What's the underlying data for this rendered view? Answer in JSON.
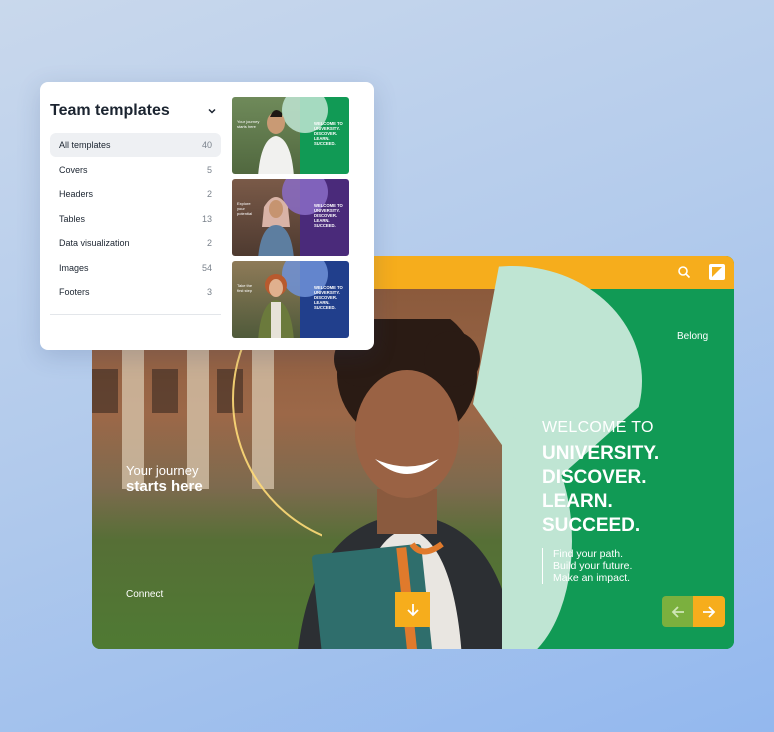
{
  "panel": {
    "title": "Team templates",
    "categories": [
      {
        "label": "All templates",
        "count": "40",
        "active": true
      },
      {
        "label": "Covers",
        "count": "5"
      },
      {
        "label": "Headers",
        "count": "2"
      },
      {
        "label": "Tables",
        "count": "13"
      },
      {
        "label": "Data visualization",
        "count": "2"
      },
      {
        "label": "Images",
        "count": "54"
      },
      {
        "label": "Footers",
        "count": "3"
      }
    ],
    "thumbnails": [
      {
        "left_text": "Your journey\nstarts here",
        "right_text": "WELCOME TO\nUNIVERSITY.\nDISCOVER.\nLEARN.\nSUCCEED.",
        "panel_color": "#119a55"
      },
      {
        "left_text": "Explore\nyour\npotential",
        "right_text": "WELCOME TO\nUNIVERSITY.\nDISCOVER.\nLEARN.\nSUCCEED.",
        "panel_color": "#4a2a7a"
      },
      {
        "left_text": "Take the\nfirst step",
        "right_text": "WELCOME TO\nUNIVERSITY.\nDISCOVER.\nLEARN.\nSUCCEED.",
        "panel_color": "#213f8c"
      }
    ]
  },
  "site": {
    "journey_line1": "Your journey",
    "journey_line2": "starts here",
    "connect": "Connect",
    "belong": "Belong",
    "welcome": "WELCOME TO",
    "headline": [
      "UNIVERSITY.",
      "DISCOVER.",
      "LEARN.",
      "SUCCEED."
    ],
    "sub": [
      "Find your path.",
      "Build your future.",
      "Make an impact."
    ],
    "icons": {
      "search": "search-icon",
      "logo": "logo-icon",
      "down": "arrow-down-icon",
      "prev": "arrow-left-icon",
      "next": "arrow-right-icon",
      "chevron": "chevron-down-icon"
    },
    "colors": {
      "accent": "#f6ad1c",
      "green": "#119a55",
      "mint": "#bfe5d3"
    }
  }
}
